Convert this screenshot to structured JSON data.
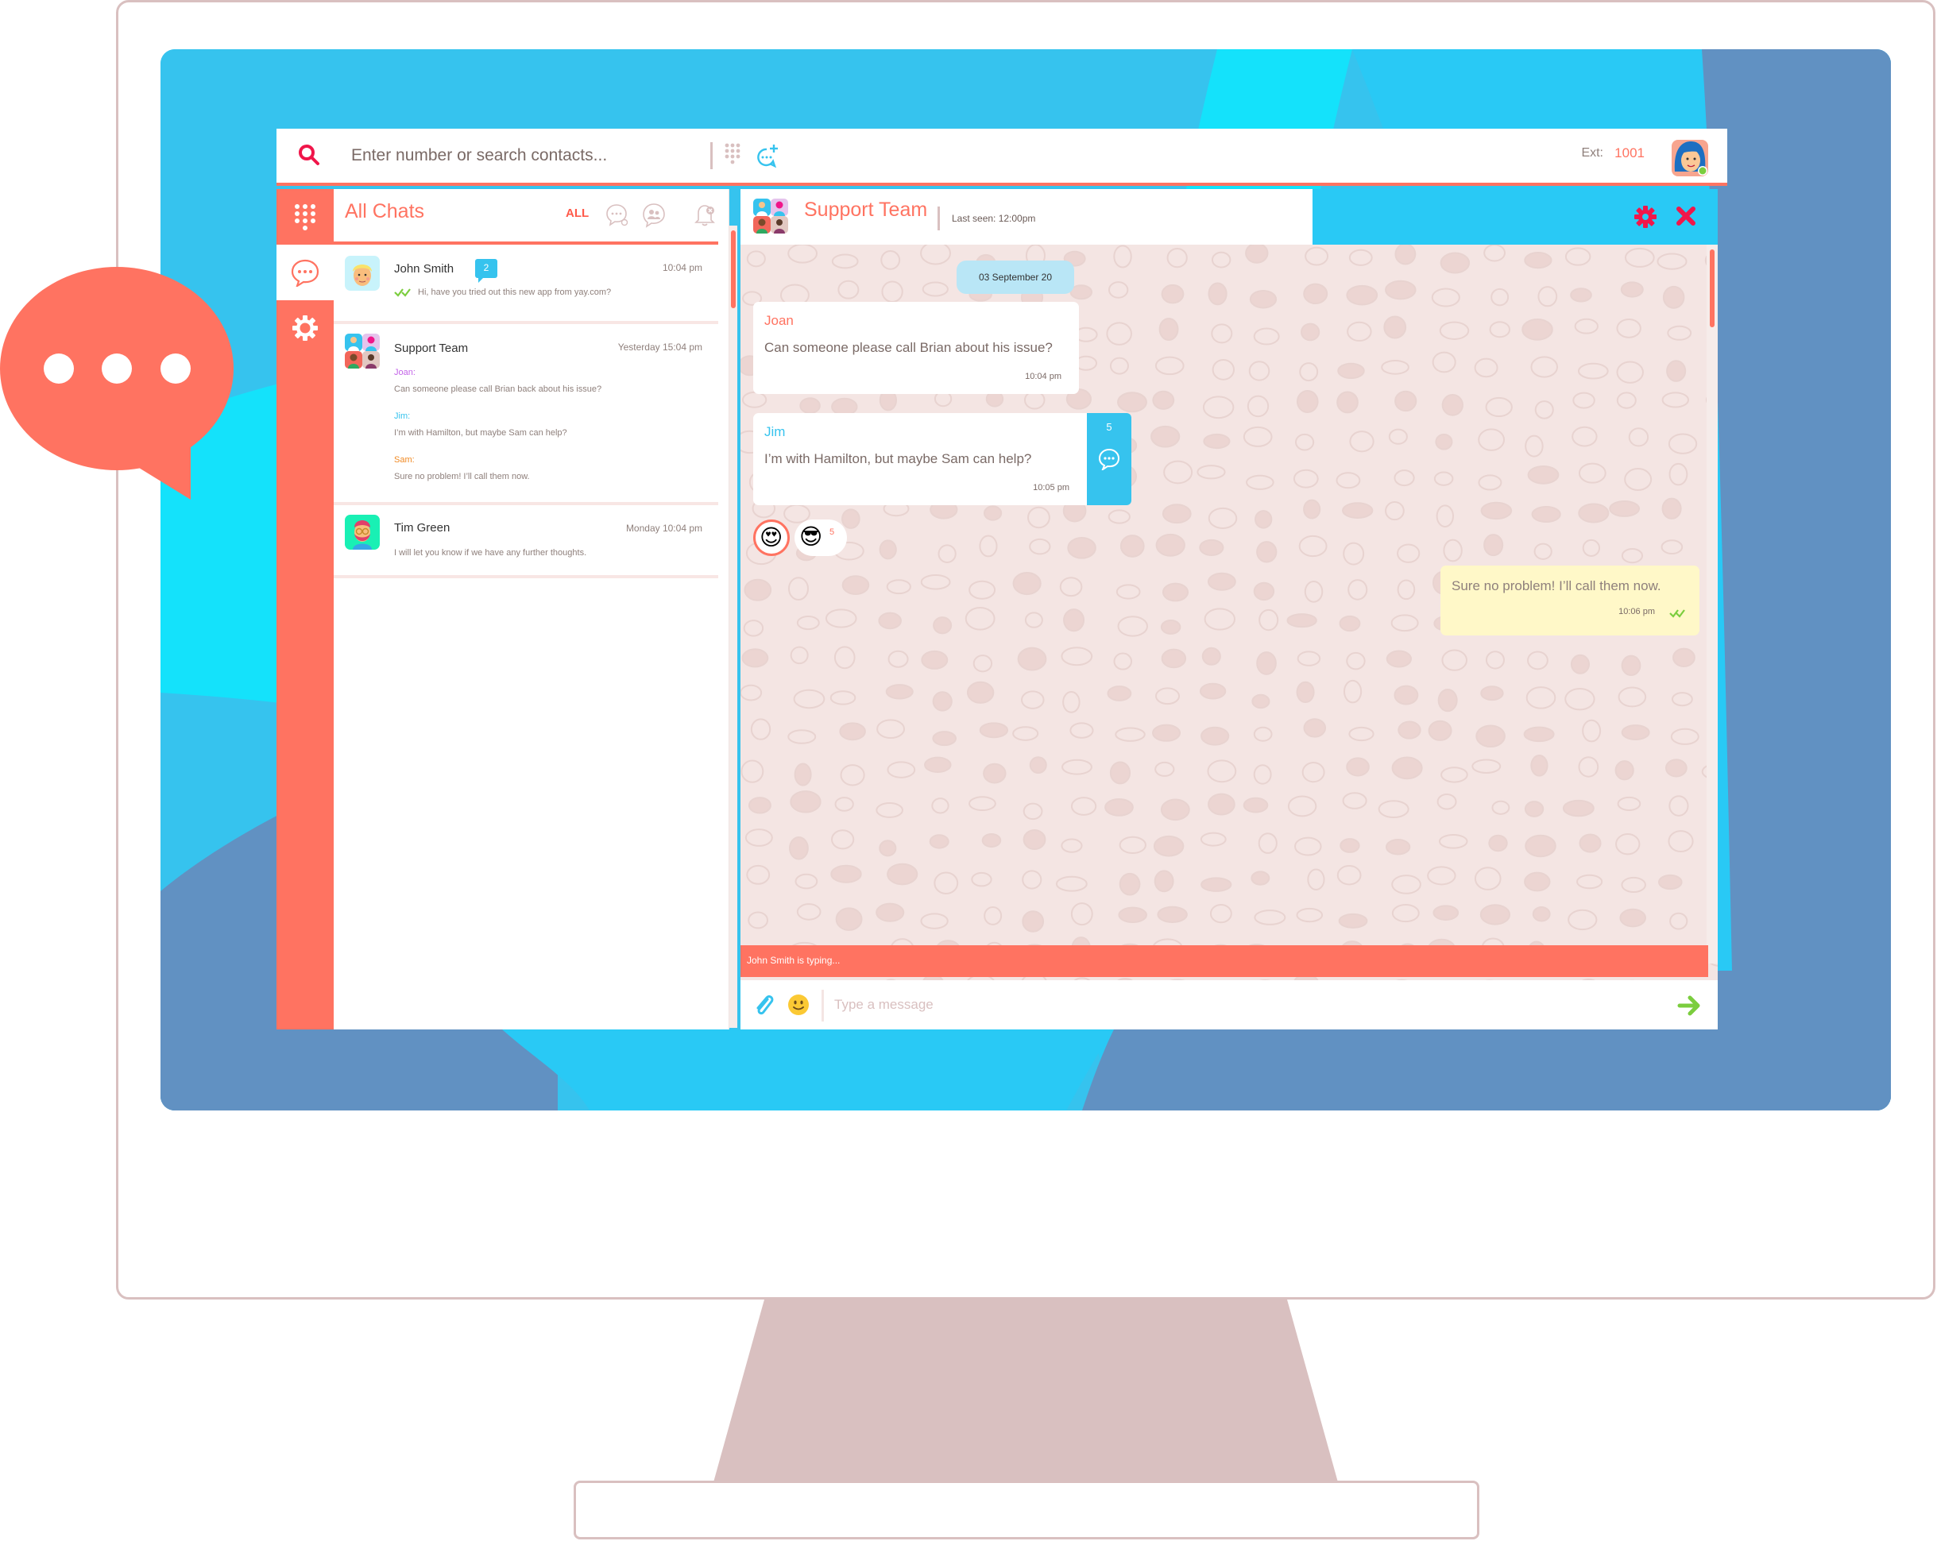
{
  "colors": {
    "accent": "#ff7361",
    "accent_dark": "#f0164a",
    "blue": "#36c3ee",
    "header_blue": "#29c9f5",
    "bg_cyan": "#14e2fb",
    "bg_steel": "#6191c2",
    "green": "#7bcd3e",
    "monitor": "#d9c0c0",
    "chat_bg": "#f4e5e3",
    "own_bubble": "#fff8c8",
    "joan": "#c363e8",
    "jim": "#36c3ee",
    "sam": "#f08a24"
  },
  "topbar": {
    "search_placeholder": "Enter number or search contacts...",
    "ext_label": "Ext:",
    "ext_number": "1001",
    "user_status": "online"
  },
  "leftnav": {
    "items": [
      {
        "icon": "dialpad-icon",
        "label": "Dialpad",
        "active": false
      },
      {
        "icon": "chat-icon",
        "label": "Chats",
        "active": true
      },
      {
        "icon": "settings-icon",
        "label": "Settings",
        "active": false
      }
    ]
  },
  "chat_list": {
    "title": "All Chats",
    "filter_all": "ALL",
    "filters": [
      "direct-chats-icon",
      "group-chats-icon",
      "muted-notifications-icon"
    ],
    "items": [
      {
        "name": "John Smith",
        "time": "10:04 pm",
        "unread": "2",
        "read_receipt": "double-check",
        "preview": "Hi, have you tried out this new app from yay.com?"
      },
      {
        "name": "Support Team",
        "time": "Yesterday 15:04 pm",
        "messages": [
          {
            "sender": "Joan:",
            "text": "Can someone please call Brian back about his issue?"
          },
          {
            "sender": "Jim:",
            "text": "I’m with Hamilton, but maybe Sam can help?"
          },
          {
            "sender": "Sam:",
            "text": "Sure no problem! I’ll call them now."
          }
        ]
      },
      {
        "name": "Tim Green",
        "time": "Monday 10:04 pm",
        "preview": "I will let you know if we have any further thoughts."
      }
    ]
  },
  "chat": {
    "title": "Support Team",
    "last_seen": "Last seen: 12:00pm",
    "date_divider": "03 September 20",
    "messages": [
      {
        "sender": "Joan",
        "text": "Can someone please call Brian about his issue?",
        "time": "10:04 pm"
      },
      {
        "sender": "Jim",
        "text": "I’m with Hamilton, but maybe Sam can help?",
        "time": "10:05 pm",
        "thread_replies": "5"
      },
      {
        "sender": "me",
        "text": "Sure no problem! I’ll call them now.",
        "time": "10:06 pm",
        "read_receipt": "double-check"
      }
    ],
    "reactions": [
      {
        "emoji": "heart-eyes",
        "glyph": "😍",
        "selected": true
      },
      {
        "emoji": "sunglasses",
        "glyph": "😎",
        "count": "5"
      }
    ],
    "typing_indicator": "John Smith is typing...",
    "composer_placeholder": "Type a message"
  }
}
